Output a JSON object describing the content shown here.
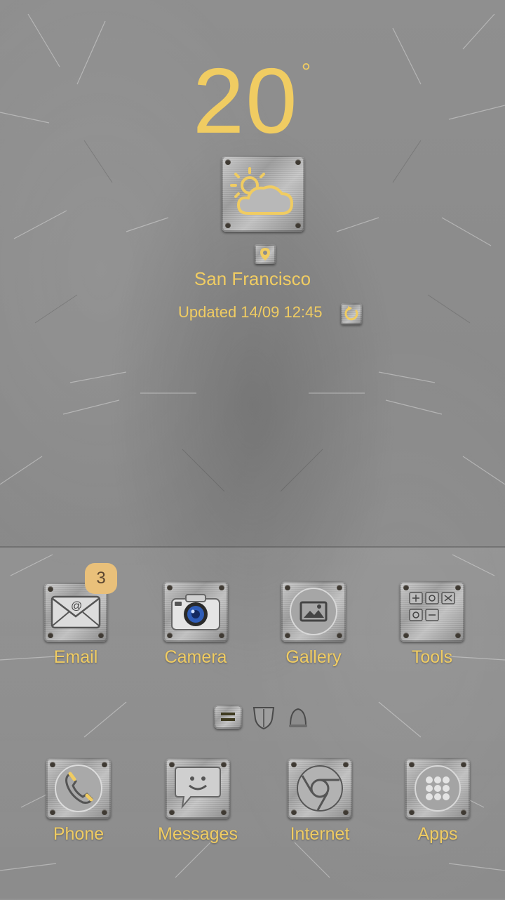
{
  "weather": {
    "temperature": "20",
    "degree_symbol": "°",
    "icon": "partly-sunny-icon",
    "location_icon": "location-pin-icon",
    "city": "San Francisco",
    "updated_text": "Updated 14/09 12:45",
    "refresh_icon": "refresh-icon"
  },
  "colors": {
    "accent": "#f0cc62",
    "badge": "#e9c07a",
    "background": "#8b8b8b"
  },
  "top_apps": [
    {
      "label": "Email",
      "icon": "envelope-icon",
      "badge": "3"
    },
    {
      "label": "Camera",
      "icon": "camera-icon"
    },
    {
      "label": "Gallery",
      "icon": "picture-icon"
    },
    {
      "label": "Tools",
      "icon": "tools-folder-icon"
    }
  ],
  "page_indicator": [
    {
      "icon": "menu-lines-icon"
    },
    {
      "icon": "shield-icon"
    },
    {
      "icon": "bell-icon"
    }
  ],
  "dock_apps": [
    {
      "label": "Phone",
      "icon": "phone-icon"
    },
    {
      "label": "Messages",
      "icon": "message-bubble-icon"
    },
    {
      "label": "Internet",
      "icon": "chrome-browser-icon"
    },
    {
      "label": "Apps",
      "icon": "app-grid-icon"
    }
  ]
}
